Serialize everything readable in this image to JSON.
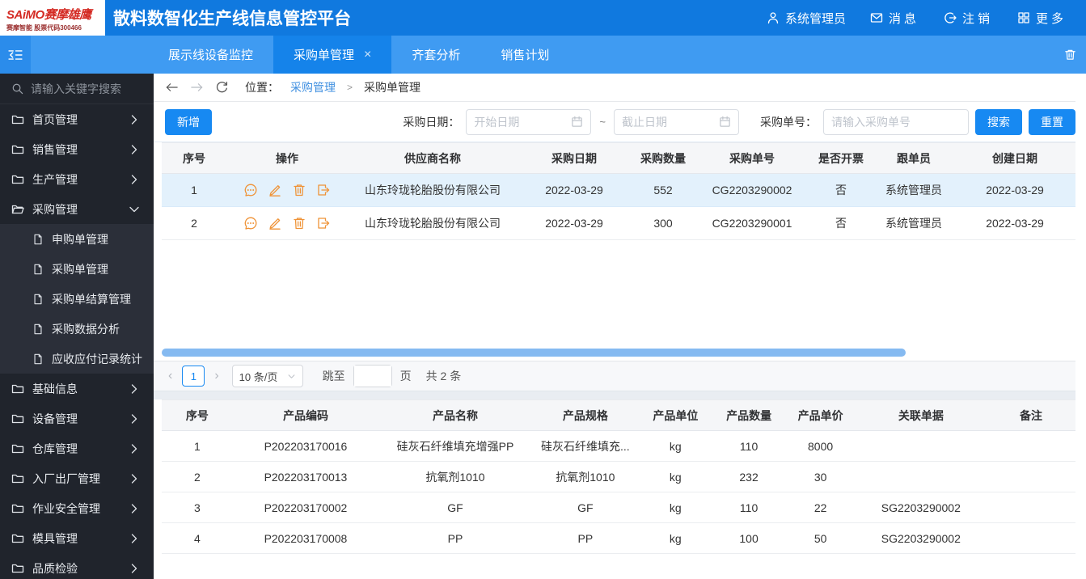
{
  "colors": {
    "header_blue": "#1079df",
    "tabbar_blue": "#3f9bf2",
    "active_tab_blue": "#1583ea",
    "button_blue": "#1789f2",
    "link_blue": "#3f8fe0",
    "action_orange": "#ef9337",
    "sidebar_dark": "#20242c",
    "selected_row_blue": "#e3f1fc",
    "scrollbar_blue": "#85baf1"
  },
  "header": {
    "logo_line1": "SAiMO赛摩雄鹰",
    "logo_line2": "赛摩智能 股票代码300466",
    "title": "散料数智化生产线信息管控平台",
    "nav_items": [
      {
        "icon": "user",
        "label": "系统管理员",
        "spaced": false
      },
      {
        "icon": "mail",
        "label": "消息",
        "spaced": true
      },
      {
        "icon": "logout",
        "label": "注销",
        "spaced": true
      },
      {
        "icon": "grid",
        "label": "更多",
        "spaced": true
      }
    ]
  },
  "tabbar": {
    "tabs": [
      {
        "label": "展示线设备监控",
        "active": false,
        "closable": false
      },
      {
        "label": "采购单管理",
        "active": true,
        "closable": true
      },
      {
        "label": "齐套分析",
        "active": false,
        "closable": false
      },
      {
        "label": "销售计划",
        "active": false,
        "closable": false
      }
    ]
  },
  "sidebar": {
    "search_placeholder": "请输入关键字搜索",
    "menu": [
      {
        "label": "首页管理",
        "state": "collapsed"
      },
      {
        "label": "销售管理",
        "state": "collapsed"
      },
      {
        "label": "生产管理",
        "state": "collapsed"
      },
      {
        "label": "采购管理",
        "state": "expanded",
        "children": [
          "申购单管理",
          "采购单管理",
          "采购单结算管理",
          "采购数据分析",
          "应收应付记录统计"
        ]
      },
      {
        "label": "基础信息",
        "state": "collapsed"
      },
      {
        "label": "设备管理",
        "state": "collapsed"
      },
      {
        "label": "仓库管理",
        "state": "collapsed"
      },
      {
        "label": "入厂出厂管理",
        "state": "collapsed"
      },
      {
        "label": "作业安全管理",
        "state": "collapsed"
      },
      {
        "label": "模具管理",
        "state": "collapsed"
      },
      {
        "label": "品质检验",
        "state": "collapsed"
      }
    ]
  },
  "breadcrumb": {
    "prefix": "位置：",
    "parent": "采购管理",
    "separator": ">",
    "current": "采购单管理"
  },
  "toolbar": {
    "add_label": "新增",
    "date_label": "采购日期：",
    "start_placeholder": "开始日期",
    "tilde": "~",
    "end_placeholder": "截止日期",
    "order_label": "采购单号：",
    "order_placeholder": "请输入采购单号",
    "search_label": "搜索",
    "reset_label": "重置"
  },
  "orders_table": {
    "columns": [
      "序号",
      "操作",
      "供应商名称",
      "采购日期",
      "采购数量",
      "采购单号",
      "是否开票",
      "跟单员",
      "创建日期"
    ],
    "action_icons": [
      "comment",
      "edit",
      "delete",
      "export"
    ],
    "rows": [
      {
        "seq": "1",
        "supplier": "山东玲珑轮胎股份有限公司",
        "date": "2022-03-29",
        "qty": "552",
        "order_no": "CG2203290002",
        "invoiced": "否",
        "follower": "系统管理员",
        "created": "2022-03-29",
        "selected": true
      },
      {
        "seq": "2",
        "supplier": "山东玲珑轮胎股份有限公司",
        "date": "2022-03-29",
        "qty": "300",
        "order_no": "CG2203290001",
        "invoiced": "否",
        "follower": "系统管理员",
        "created": "2022-03-29",
        "selected": false
      }
    ]
  },
  "pagination": {
    "page": "1",
    "page_size": "10 条/页",
    "jump_label": "跳至",
    "page_suffix": "页",
    "total": "共 2 条"
  },
  "products_table": {
    "columns": [
      "序号",
      "产品编码",
      "产品名称",
      "产品规格",
      "产品单位",
      "产品数量",
      "产品单价",
      "关联单据",
      "备注"
    ],
    "rows": [
      [
        "1",
        "P202203170016",
        "硅灰石纤维填充增强PP",
        "硅灰石纤维填充...",
        "kg",
        "110",
        "8000",
        "",
        ""
      ],
      [
        "2",
        "P202203170013",
        "抗氧剂1010",
        "抗氧剂1010",
        "kg",
        "232",
        "30",
        "",
        ""
      ],
      [
        "3",
        "P202203170002",
        "GF",
        "GF",
        "kg",
        "110",
        "22",
        "SG2203290002",
        ""
      ],
      [
        "4",
        "P202203170008",
        "PP",
        "PP",
        "kg",
        "100",
        "50",
        "SG2203290002",
        ""
      ]
    ]
  }
}
